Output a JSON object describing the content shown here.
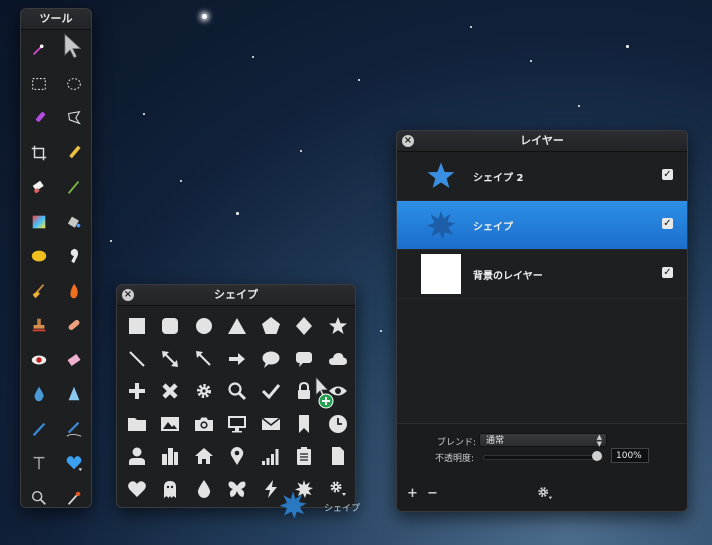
{
  "tools_panel": {
    "title": "ツール"
  },
  "shapes_panel": {
    "title": "シェイプ",
    "drag_label": "シェイプ"
  },
  "layers_panel": {
    "title": "レイヤー",
    "layers": [
      {
        "name": "シェイプ 2",
        "thumb": "star-icon",
        "checked": true,
        "selected": false
      },
      {
        "name": "シェイプ",
        "thumb": "starburst-icon",
        "checked": true,
        "selected": true
      },
      {
        "name": "背景のレイヤー",
        "thumb": "white-square",
        "checked": true,
        "selected": false
      }
    ],
    "blend_label": "ブレンド:",
    "blend_value": "通常",
    "opacity_label": "不透明度:",
    "opacity_value": "100%",
    "opacity_fraction": 1.0
  },
  "colors": {
    "selection_blue": "#2d8fe6",
    "star_blue": "#3b8fe0",
    "heart_blue": "#3aa0f0"
  }
}
